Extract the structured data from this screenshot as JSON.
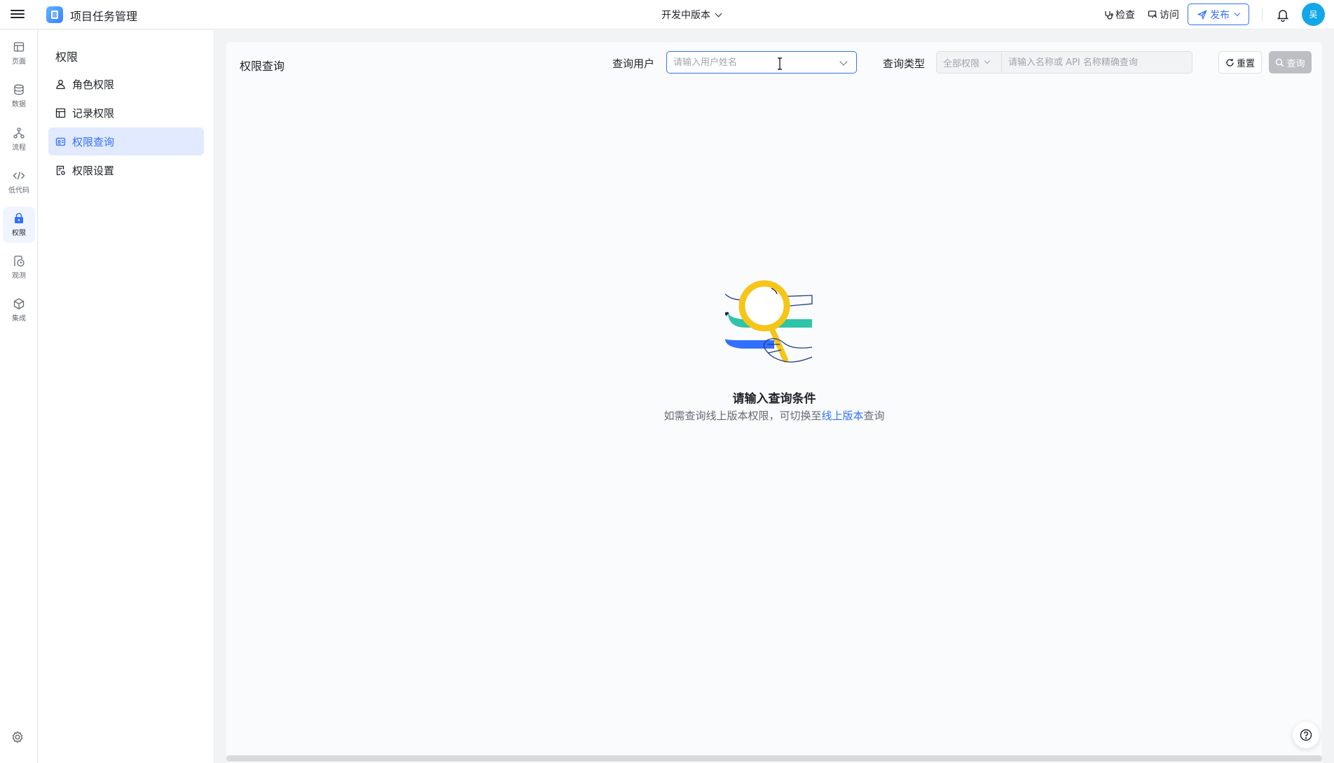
{
  "header": {
    "app_title": "项目任务管理",
    "version_label": "开发中版本",
    "check_label": "检查",
    "visit_label": "访问",
    "publish_label": "发布",
    "avatar_text": "吴"
  },
  "rail": {
    "items": [
      {
        "label": "页面",
        "icon": "page-icon"
      },
      {
        "label": "数据",
        "icon": "database-icon"
      },
      {
        "label": "流程",
        "icon": "flow-icon"
      },
      {
        "label": "低代码",
        "icon": "code-icon"
      },
      {
        "label": "权限",
        "icon": "lock-icon",
        "active": true
      },
      {
        "label": "观测",
        "icon": "monitor-icon"
      },
      {
        "label": "集成",
        "icon": "cube-icon"
      }
    ]
  },
  "subnav": {
    "title": "权限",
    "items": [
      {
        "label": "角色权限",
        "icon": "user-icon"
      },
      {
        "label": "记录权限",
        "icon": "table-icon"
      },
      {
        "label": "权限查询",
        "icon": "id-card-icon",
        "active": true
      },
      {
        "label": "权限设置",
        "icon": "settings-doc-icon"
      }
    ]
  },
  "main": {
    "title": "权限查询",
    "user_label": "查询用户",
    "user_placeholder": "请输入用户姓名",
    "type_label": "查询类型",
    "type_value": "全部权限",
    "type_input_placeholder": "请输入名称或 API 名称精确查询",
    "reset_label": "重置",
    "query_label": "查询",
    "empty_title": "请输入查询条件",
    "empty_desc_prefix": "如需查询线上版本权限，可切换至",
    "empty_desc_link": "线上版本",
    "empty_desc_suffix": "查询"
  },
  "colors": {
    "accent": "#3370ff",
    "active_bg": "#e1eaff",
    "avatar": "#12a7e8"
  }
}
